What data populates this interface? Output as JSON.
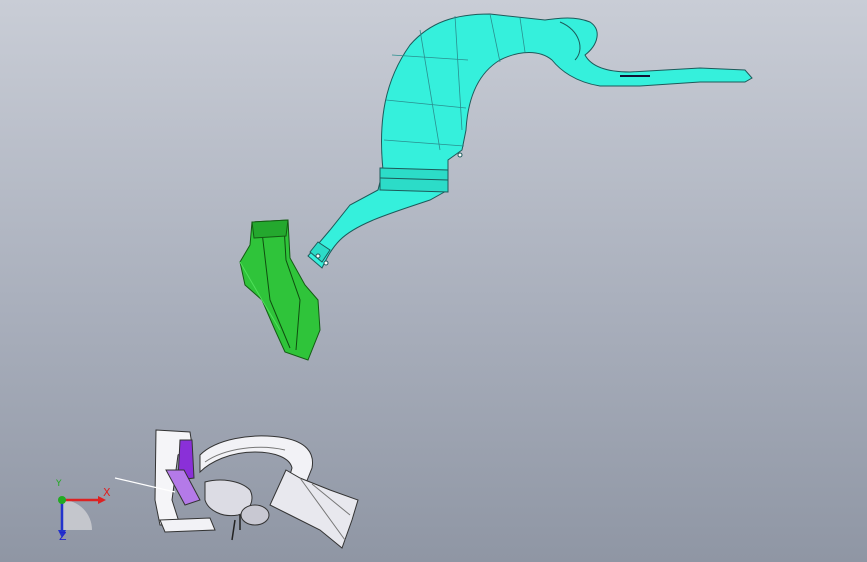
{
  "triad": {
    "x_label": "X",
    "y_label": "Y",
    "z_label": "Z"
  },
  "colors": {
    "background_top": "#c9cdd6",
    "background_bottom": "#8f96a4",
    "duct_cyan": "#35f0dc",
    "part_green": "#2fc43a",
    "assembly_white": "#f2f2f6",
    "assembly_purple": "#8a30d8",
    "axis_x": "#dd2222",
    "axis_y": "#22aa22",
    "axis_z": "#2233cc"
  },
  "icons": [
    "triad-icon"
  ]
}
